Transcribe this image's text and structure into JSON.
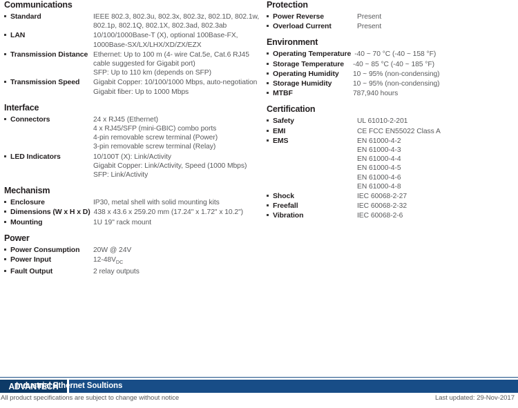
{
  "left_column": [
    {
      "title": "Communications",
      "label_width": "lw-120",
      "rows": [
        {
          "label": "Standard",
          "value": "IEEE 802.3, 802.3u, 802.3x, 802.3z, 802.1D, 802.1w,\n802.1p, 802.1Q, 802.1X, 802.3ad, 802.3ab"
        },
        {
          "label": "LAN",
          "value": "10/100/1000Base-T (X), optional 100Base-FX,\n1000Base-SX/LX/LHX/XD/ZX/EZX"
        },
        {
          "label": "Transmission Distance",
          "value": "Ethernet: Up to 100 m (4- wire Cat.5e, Cat.6 RJ45\ncable suggested for Gigabit port)\nSFP: Up to 110 km (depends on SFP)"
        },
        {
          "label": "Transmission Speed",
          "value": "Gigabit Copper: 10/100/1000 Mbps, auto-negotiation\nGigabit fiber: Up to 1000 Mbps"
        }
      ]
    },
    {
      "title": "Interface",
      "label_width": "lw-120",
      "rows": [
        {
          "label": "Connectors",
          "value": "24 x RJ45 (Ethernet)\n4 x RJ45/SFP (mini-GBIC) combo ports\n4-pin removable screw terminal (Power)\n3-pin removable screw terminal (Relay)"
        },
        {
          "label": "LED Indicators",
          "value": "10/100T (X): Link/Activity\nGigabit Copper: Link/Activity, Speed (1000 Mbps)\nSFP: Link/Activity"
        }
      ]
    },
    {
      "title": "Mechanism",
      "label_width": "lw-120",
      "rows": [
        {
          "label": "Enclosure",
          "value": "IP30, metal shell with solid mounting kits"
        },
        {
          "label": "Dimensions (W x H x D)",
          "value": "438 x 43.6 x 259.20 mm (17.24\" x 1.72\" x 10.2\")",
          "tight": true
        },
        {
          "label": "Mounting",
          "value": "1U 19\" rack mount"
        }
      ]
    },
    {
      "title": "Power",
      "label_width": "lw-120",
      "rows": [
        {
          "label": "Power Consumption",
          "value": "20W @ 24V"
        },
        {
          "label": "Power Input",
          "value": "12-48V",
          "subscript": "DC"
        },
        {
          "label": "Fault Output",
          "value": "2 relay outputs"
        }
      ]
    }
  ],
  "right_column": [
    {
      "title": "Protection",
      "label_width": "lw-prot",
      "rows": [
        {
          "label": "Power Reverse",
          "value": "Present"
        },
        {
          "label": "Overload Current",
          "value": "Present"
        }
      ]
    },
    {
      "title": "Environment",
      "label_width": "lw-env",
      "rows": [
        {
          "label": "Operating Temperature",
          "value": "-40 ~ 70 °C (-40 ~ 158 °F)",
          "tight": true
        },
        {
          "label": "Storage Temperature",
          "value": "-40 ~ 85 °C (-40 ~ 185 °F)"
        },
        {
          "label": "Operating Humidity",
          "value": "10 ~ 95% (non-condensing)"
        },
        {
          "label": "Storage Humidity",
          "value": "10 ~ 95% (non-condensing)"
        },
        {
          "label": "MTBF",
          "value": "787,940 hours"
        }
      ]
    },
    {
      "title": "Certification",
      "label_width": "lw-cert",
      "rows": [
        {
          "label": "Safety",
          "value": "UL 61010-2-201"
        },
        {
          "label": "EMI",
          "value": "CE FCC EN55022 Class A"
        },
        {
          "label": "EMS",
          "value": "EN 61000-4-2\nEN 61000-4-3\nEN 61000-4-4\nEN 61000-4-5\nEN 61000-4-6\nEN 61000-4-8"
        },
        {
          "label": "Shock",
          "value": "IEC 60068-2-27"
        },
        {
          "label": "Freefall",
          "value": "IEC 60068-2-32"
        },
        {
          "label": "Vibration",
          "value": "IEC 60068-2-6"
        }
      ]
    }
  ],
  "footer": {
    "logo": "ADVANTECH",
    "banner": "Industrial Ethernet Soultions",
    "disclaimer": "All product specifications are subject to change without notice",
    "last_updated": "Last updated: 29-Nov-2017",
    "logo_color": "#0d3a67",
    "banner_color": "#184d87"
  }
}
